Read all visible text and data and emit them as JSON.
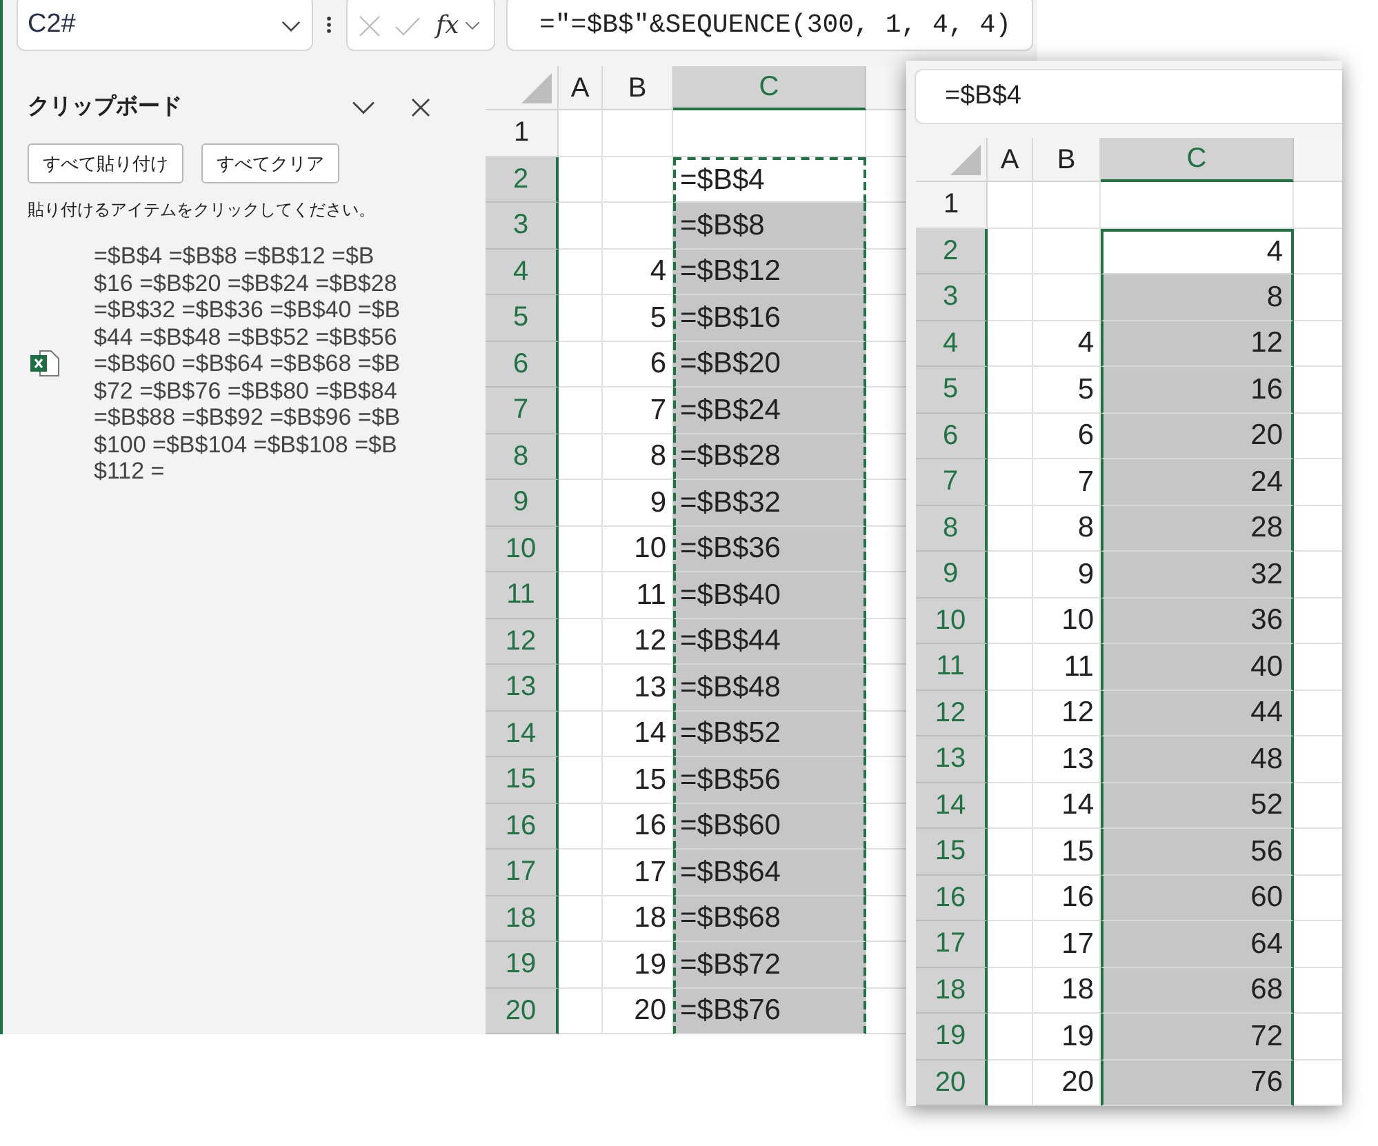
{
  "name_box": {
    "value": "C2#"
  },
  "formula_bar": {
    "edit_buttons_disabled": true,
    "function_label": "fx",
    "formula": "=\"=$B$\"&SEQUENCE(300, 1, 4, 4)"
  },
  "clipboard_pane": {
    "title": "クリップボード",
    "buttons": [
      "すべて貼り付け",
      "すべてクリア"
    ],
    "hint": "貼り付けるアイテムをクリックしてください。",
    "items": [
      {
        "kind": "excel",
        "text": "=$B$4 =$B$8 =$B$12 =$B\n$16 =$B$20 =$B$24 =$B$28\n=$B$32 =$B$36 =$B$40 =$B\n$44 =$B$48 =$B$52 =$B$56\n=$B$60 =$B$64 =$B$68 =$B\n$72 =$B$76 =$B$80 =$B$84\n=$B$88 =$B$92 =$B$96 =$B\n$100 =$B$104 =$B$108 =$B\n$112 ="
      }
    ]
  },
  "sheet": {
    "copy_marquee": true,
    "numeric_values": false,
    "columns": [
      {
        "label": "A",
        "selected": false
      },
      {
        "label": "B",
        "selected": false
      },
      {
        "label": "C",
        "selected": true
      }
    ],
    "rows": [
      {
        "label": "1",
        "selected": false,
        "active": false
      },
      {
        "label": "2",
        "selected": true,
        "active": true,
        "c": "=$B$4"
      },
      {
        "label": "3",
        "selected": true,
        "active": false,
        "c": "=$B$8"
      },
      {
        "label": "4",
        "selected": true,
        "active": false,
        "b": "4",
        "c": "=$B$12"
      },
      {
        "label": "5",
        "selected": true,
        "active": false,
        "b": "5",
        "c": "=$B$16"
      },
      {
        "label": "6",
        "selected": true,
        "active": false,
        "b": "6",
        "c": "=$B$20"
      },
      {
        "label": "7",
        "selected": true,
        "active": false,
        "b": "7",
        "c": "=$B$24"
      },
      {
        "label": "8",
        "selected": true,
        "active": false,
        "b": "8",
        "c": "=$B$28"
      },
      {
        "label": "9",
        "selected": true,
        "active": false,
        "b": "9",
        "c": "=$B$32"
      },
      {
        "label": "10",
        "selected": true,
        "active": false,
        "b": "10",
        "c": "=$B$36"
      },
      {
        "label": "11",
        "selected": true,
        "active": false,
        "b": "11",
        "c": "=$B$40"
      },
      {
        "label": "12",
        "selected": true,
        "active": false,
        "b": "12",
        "c": "=$B$44"
      },
      {
        "label": "13",
        "selected": true,
        "active": false,
        "b": "13",
        "c": "=$B$48"
      },
      {
        "label": "14",
        "selected": true,
        "active": false,
        "b": "14",
        "c": "=$B$52"
      },
      {
        "label": "15",
        "selected": true,
        "active": false,
        "b": "15",
        "c": "=$B$56"
      },
      {
        "label": "16",
        "selected": true,
        "active": false,
        "b": "16",
        "c": "=$B$60"
      },
      {
        "label": "17",
        "selected": true,
        "active": false,
        "b": "17",
        "c": "=$B$64"
      },
      {
        "label": "18",
        "selected": true,
        "active": false,
        "b": "18",
        "c": "=$B$68"
      },
      {
        "label": "19",
        "selected": true,
        "active": false,
        "b": "19",
        "c": "=$B$72"
      },
      {
        "label": "20",
        "selected": true,
        "active": false,
        "b": "20",
        "c": "=$B$76"
      }
    ]
  },
  "inset": {
    "formula": "=$B$4",
    "copy_marquee": false,
    "numeric_values": true,
    "columns": [
      {
        "label": "A",
        "selected": false
      },
      {
        "label": "B",
        "selected": false
      },
      {
        "label": "C",
        "selected": true
      }
    ],
    "rows": [
      {
        "label": "1",
        "selected": false,
        "active": false
      },
      {
        "label": "2",
        "selected": true,
        "active": true,
        "c": "4"
      },
      {
        "label": "3",
        "selected": true,
        "active": false,
        "c": "8"
      },
      {
        "label": "4",
        "selected": true,
        "active": false,
        "b": "4",
        "c": "12"
      },
      {
        "label": "5",
        "selected": true,
        "active": false,
        "b": "5",
        "c": "16"
      },
      {
        "label": "6",
        "selected": true,
        "active": false,
        "b": "6",
        "c": "20"
      },
      {
        "label": "7",
        "selected": true,
        "active": false,
        "b": "7",
        "c": "24"
      },
      {
        "label": "8",
        "selected": true,
        "active": false,
        "b": "8",
        "c": "28"
      },
      {
        "label": "9",
        "selected": true,
        "active": false,
        "b": "9",
        "c": "32"
      },
      {
        "label": "10",
        "selected": true,
        "active": false,
        "b": "10",
        "c": "36"
      },
      {
        "label": "11",
        "selected": true,
        "active": false,
        "b": "11",
        "c": "40"
      },
      {
        "label": "12",
        "selected": true,
        "active": false,
        "b": "12",
        "c": "44"
      },
      {
        "label": "13",
        "selected": true,
        "active": false,
        "b": "13",
        "c": "48"
      },
      {
        "label": "14",
        "selected": true,
        "active": false,
        "b": "14",
        "c": "52"
      },
      {
        "label": "15",
        "selected": true,
        "active": false,
        "b": "15",
        "c": "56"
      },
      {
        "label": "16",
        "selected": true,
        "active": false,
        "b": "16",
        "c": "60"
      },
      {
        "label": "17",
        "selected": true,
        "active": false,
        "b": "17",
        "c": "64"
      },
      {
        "label": "18",
        "selected": true,
        "active": false,
        "b": "18",
        "c": "68"
      },
      {
        "label": "19",
        "selected": true,
        "active": false,
        "b": "19",
        "c": "72"
      },
      {
        "label": "20",
        "selected": true,
        "active": false,
        "b": "20",
        "c": "76"
      }
    ]
  }
}
